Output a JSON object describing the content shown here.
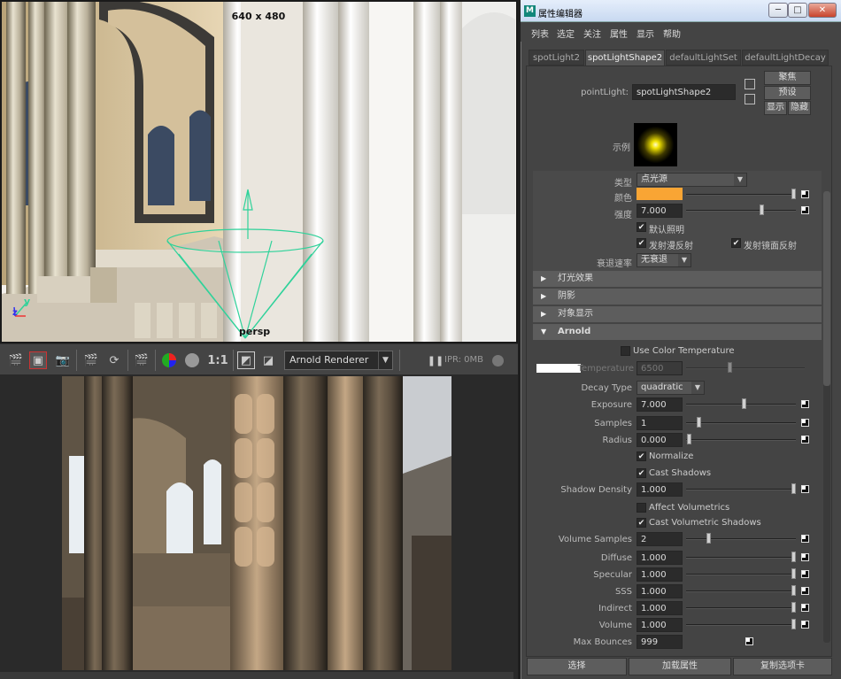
{
  "viewport": {
    "resolution_label": "640 x 480",
    "camera_label": "persp",
    "axis_y": "y",
    "axis_z": "z"
  },
  "render_toolbar": {
    "ratio_label": "1:1",
    "renderer": "Arnold Renderer",
    "ipr_label": "IPR: 0MB"
  },
  "window": {
    "title": "属性编辑器",
    "app_icon_letter": "M",
    "minimize": "─",
    "maximize": "□",
    "close": "✕"
  },
  "menu": [
    "列表",
    "选定",
    "关注",
    "属性",
    "显示",
    "帮助"
  ],
  "tabs": [
    "spotLight2",
    "spotLightShape2",
    "defaultLightSet",
    "defaultLightDecay"
  ],
  "node": {
    "type_label": "pointLight:",
    "name_value": "spotLightShape2",
    "focus_button": "聚焦",
    "presets_button": "预设",
    "show_button": "显示",
    "hide_button": "隐藏",
    "sample_label": "示例"
  },
  "light_attrs": {
    "type_label": "类型",
    "type_value": "点光源",
    "color_label": "颜色",
    "color_hex": "#F9A534",
    "intensity_label": "强度",
    "intensity_value": "7.000",
    "intensity_slider": 0.58,
    "illuminate_default": "默认照明",
    "emit_diffuse": "发射漫反射",
    "emit_specular": "发射镜面反射",
    "decay_label": "衰退速率",
    "decay_value": "无衰退"
  },
  "sections": {
    "light_effects": "灯光效果",
    "shadows": "阴影",
    "object_display": "对象显示",
    "arnold": "Arnold"
  },
  "arnold": {
    "use_color_temp": "Use Color Temperature",
    "temperature_label": "Temperature",
    "temperature_value": "6500",
    "decay_type_label": "Decay Type",
    "decay_type_value": "quadratic",
    "exposure_label": "Exposure",
    "exposure_value": "7.000",
    "samples_label": "Samples",
    "samples_value": "1",
    "radius_label": "Radius",
    "radius_value": "0.000",
    "normalize": "Normalize",
    "cast_shadows": "Cast Shadows",
    "shadow_density_label": "Shadow Density",
    "shadow_density_value": "1.000",
    "affect_volumetrics": "Affect Volumetrics",
    "cast_volumetric_shadows": "Cast Volumetric Shadows",
    "volume_samples_label": "Volume Samples",
    "volume_samples_value": "2",
    "diffuse_label": "Diffuse",
    "diffuse_value": "1.000",
    "specular_label": "Specular",
    "specular_value": "1.000",
    "sss_label": "SSS",
    "sss_value": "1.000",
    "indirect_label": "Indirect",
    "indirect_value": "1.000",
    "volume_label": "Volume",
    "volume_value": "1.000",
    "max_bounces_label": "Max Bounces",
    "max_bounces_value": "999"
  },
  "bottom_buttons": {
    "select": "选择",
    "load_attrs": "加载属性",
    "copy_tab": "复制选项卡"
  }
}
